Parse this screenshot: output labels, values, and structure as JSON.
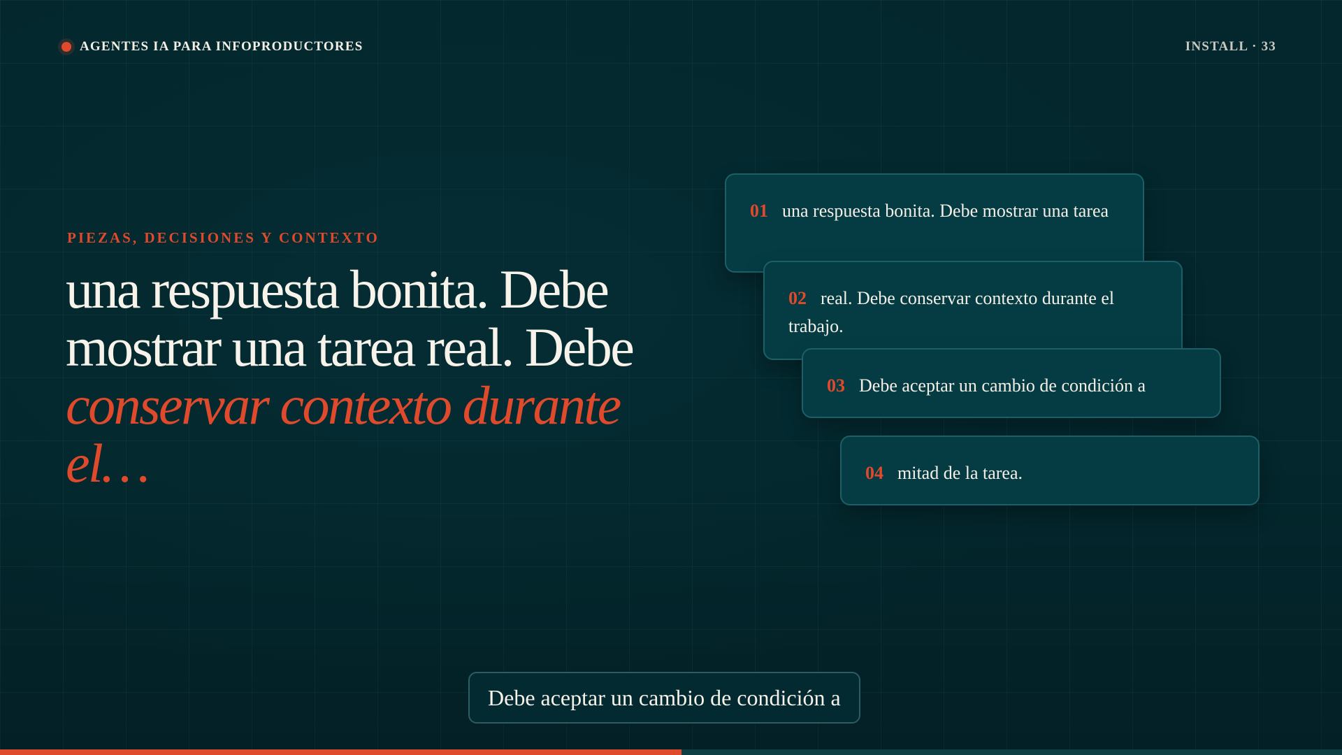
{
  "header": {
    "brand": "AGENTES IA PARA INFOPRODUCTORES",
    "page_label": "INSTALL · 33"
  },
  "hero": {
    "eyebrow": "PIEZAS, DECISIONES Y CONTEXTO",
    "title_line1": "una respuesta bonita. Debe",
    "title_line2": "mostrar una tarea real. Debe",
    "title_accent1": "conservar contexto durante",
    "title_accent2": "el…"
  },
  "cards": [
    {
      "num": "01",
      "text": "una respuesta bonita. Debe mostrar una tarea"
    },
    {
      "num": "02",
      "text": "real. Debe conservar contexto durante el trabajo."
    },
    {
      "num": "03",
      "text": "Debe aceptar un cambio de condición a"
    },
    {
      "num": "04",
      "text": "mitad de la tarea."
    }
  ],
  "caption": "Debe aceptar un cambio de condición a",
  "progress": {
    "fraction": 0.508
  },
  "colors": {
    "background": "#03272d",
    "accent": "#e04a2c",
    "card": "#053c44",
    "text": "#f3efe6"
  }
}
